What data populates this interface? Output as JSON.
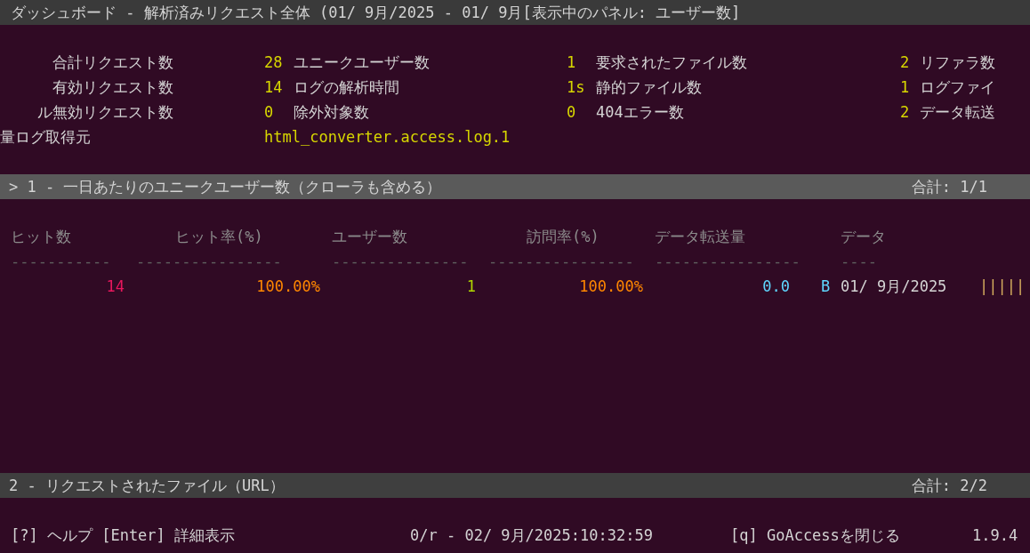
{
  "title_bar": {
    "title": "ダッシュボード - 解析済みリクエスト全体 (01/ 9月/2025 - 01/ 9月[表示中のパネル: ユーザー数]"
  },
  "overview": {
    "rows": [
      [
        {
          "label": "合計リクエスト数",
          "value": "28"
        },
        {
          "label": "ユニークユーザー数",
          "value": "1"
        },
        {
          "label": "要求されたファイル数",
          "value": "2"
        },
        {
          "label": "リファラ数"
        }
      ],
      [
        {
          "label": "有効リクエスト数",
          "value": "14"
        },
        {
          "label": "ログの解析時間",
          "value": "1s"
        },
        {
          "label": "静的ファイル数",
          "value": "1"
        },
        {
          "label": "ログファイ"
        }
      ],
      [
        {
          "label": "ル無効リクエスト数",
          "value": "0"
        },
        {
          "label": "除外対象数",
          "value": "0"
        },
        {
          "label": "404エラー数",
          "value": "2"
        },
        {
          "label": "データ転送"
        }
      ]
    ],
    "log_source": {
      "label": "量ログ取得元",
      "value": "html_converter.access.log.1"
    }
  },
  "panels": [
    {
      "header": "> 1 - 一日あたりのユニークユーザー数（クローラも含める）",
      "total": "合計: 1/1",
      "selected": true,
      "columns": [
        "ヒット数",
        "ヒット率(%)",
        "ユーザー数",
        "訪問率(%)",
        "データ転送量",
        "データ"
      ],
      "separators": [
        "-----------",
        "----------------",
        "---------------",
        "----------------",
        "----------------",
        "----"
      ],
      "rows": [
        {
          "hits": "14",
          "hit_rate": "100.00%",
          "users": "1",
          "visit_rate": "100.00%",
          "bandwidth": "0.0",
          "unit": "B",
          "date": "01/ 9月/2025",
          "bar": "|||||"
        }
      ]
    },
    {
      "header": "2 - リクエストされたファイル（URL）",
      "total": "合計: 2/2",
      "selected": false
    }
  ],
  "footer": {
    "help": "[?] ヘルプ [Enter] 詳細表示",
    "status": "0/r - 02/ 9月/2025:10:32:59",
    "quit": "[q] GoAccessを閉じる",
    "version": "1.9.4"
  }
}
